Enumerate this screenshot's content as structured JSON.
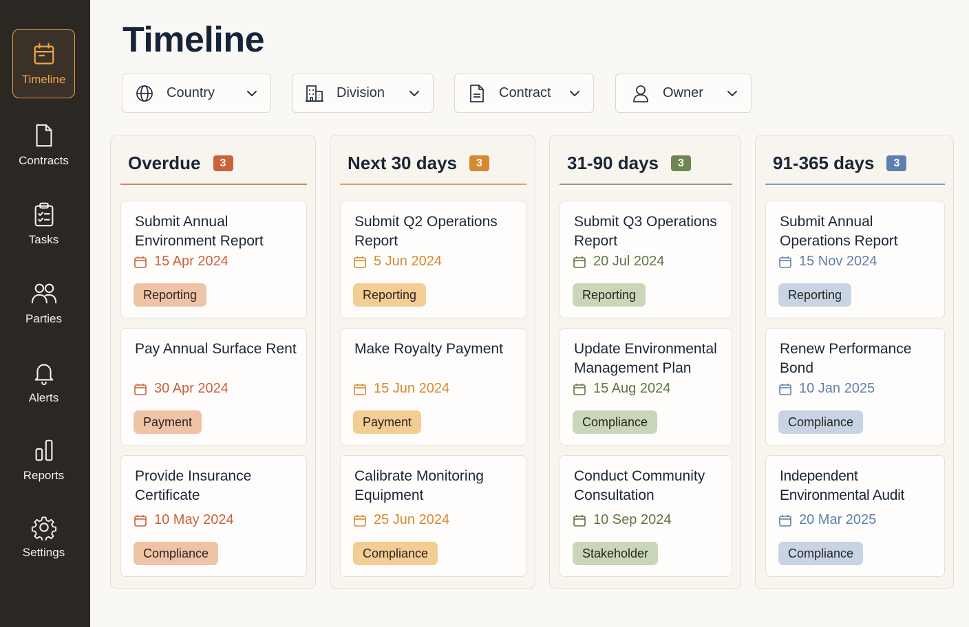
{
  "sidebar": {
    "items": [
      {
        "label": "Timeline",
        "icon": "calendar-icon",
        "active": true
      },
      {
        "label": "Contracts",
        "icon": "document-icon"
      },
      {
        "label": "Tasks",
        "icon": "clipboard-check-icon"
      },
      {
        "label": "Parties",
        "icon": "users-icon"
      },
      {
        "label": "Alerts",
        "icon": "bell-icon"
      },
      {
        "label": "Reports",
        "icon": "bar-chart-icon"
      },
      {
        "label": "Settings",
        "icon": "gear-icon"
      }
    ]
  },
  "header": {
    "title": "Timeline"
  },
  "filters": [
    {
      "label": "Country",
      "icon": "globe-icon"
    },
    {
      "label": "Division",
      "icon": "building-icon"
    },
    {
      "label": "Contract",
      "icon": "document-icon"
    },
    {
      "label": "Owner",
      "icon": "user-icon"
    }
  ],
  "colors": {
    "overdue": "#c9633a",
    "next30": "#d6892e",
    "days31_90": "#6e8752",
    "days91_365": "#5f80ad"
  },
  "columns": [
    {
      "title": "Overdue",
      "count": "3",
      "cards": [
        {
          "title": "Submit Annual Environment Report",
          "date": "15 Apr 2024",
          "tag": "Reporting"
        },
        {
          "title": "Pay Annual Surface Rent",
          "date": "30 Apr 2024",
          "tag": "Payment"
        },
        {
          "title": "Provide Insurance Certificate",
          "date": "10 May 2024",
          "tag": "Compliance"
        }
      ]
    },
    {
      "title": "Next 30 days",
      "count": "3",
      "cards": [
        {
          "title": "Submit Q2 Operations Report",
          "date": "5 Jun 2024",
          "tag": "Reporting"
        },
        {
          "title": "Make Royalty Payment",
          "date": "15 Jun 2024",
          "tag": "Payment"
        },
        {
          "title": "Calibrate Monitoring Equipment",
          "date": "25 Jun 2024",
          "tag": "Compliance"
        }
      ]
    },
    {
      "title": "31-90 days",
      "count": "3",
      "cards": [
        {
          "title": "Submit Q3 Operations Report",
          "date": "20 Jul 2024",
          "tag": "Reporting"
        },
        {
          "title": "Update Environmental Management Plan",
          "date": "15 Aug 2024",
          "tag": "Compliance"
        },
        {
          "title": "Conduct Community Consultation",
          "date": "10 Sep 2024",
          "tag": "Stakeholder"
        }
      ]
    },
    {
      "title": "91-365 days",
      "count": "3",
      "cards": [
        {
          "title": "Submit Annual Operations Report",
          "date": "15 Nov 2024",
          "tag": "Reporting"
        },
        {
          "title": "Renew Performance Bond",
          "date": "10 Jan 2025",
          "tag": "Compliance"
        },
        {
          "title": "Independent Environmental Audit",
          "date": "20 Mar 2025",
          "tag": "Compliance"
        }
      ]
    }
  ]
}
